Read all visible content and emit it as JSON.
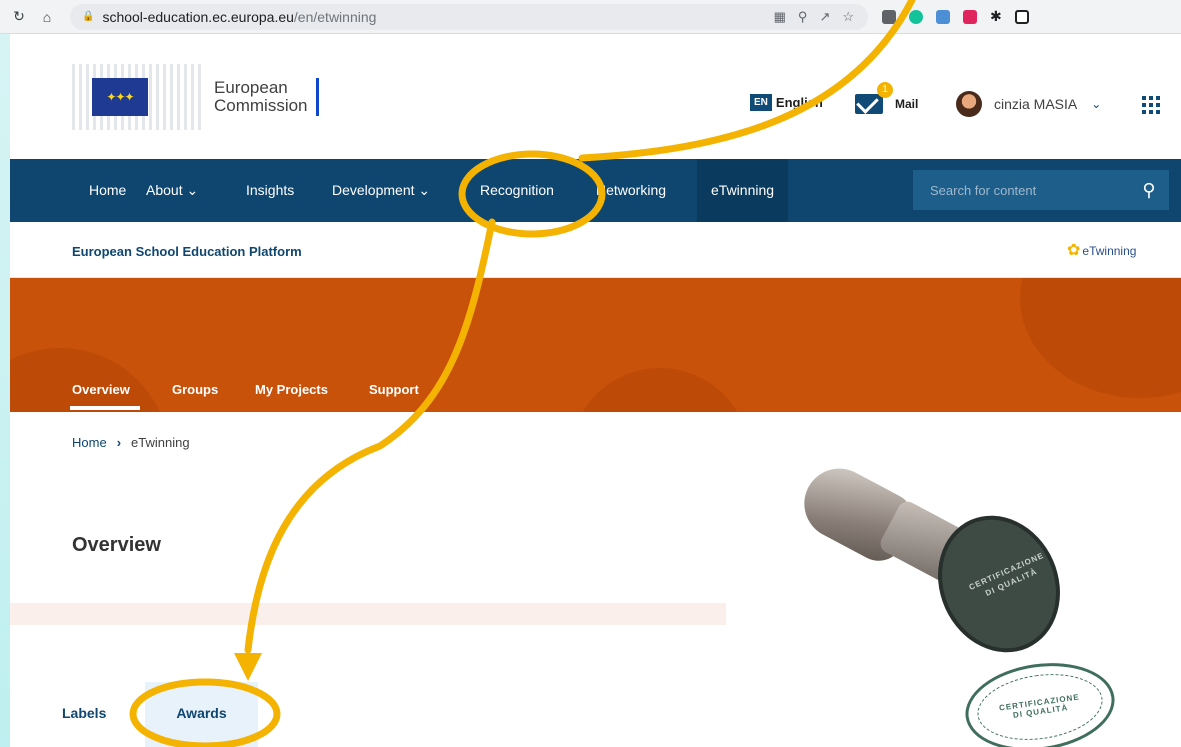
{
  "browser": {
    "url_host": "school-education.ec.europa.eu",
    "url_path": "/en/etwinning"
  },
  "header": {
    "logo_line1": "European",
    "logo_line2": "Commission",
    "lang_code": "EN",
    "lang_label": "English",
    "mail_count": "1",
    "mail_label": "Mail",
    "user_name": "cinzia MASIA"
  },
  "mainnav": {
    "items": [
      "Home",
      "About",
      "Insights",
      "Development",
      "Recognition",
      "Networking",
      "eTwinning"
    ],
    "search_placeholder": "Search for content"
  },
  "site": {
    "title": "European School Education Platform",
    "logo_text": "eTwinning"
  },
  "subnav": {
    "items": [
      "Overview",
      "Groups",
      "My Projects",
      "Support"
    ]
  },
  "breadcrumb": {
    "home": "Home",
    "current": "eTwinning"
  },
  "content": {
    "heading": "Overview",
    "tabs": [
      "Labels",
      "Awards"
    ]
  },
  "illustration": {
    "stamp_face": "CERTIFICAZIONE DI QUALITÀ",
    "imprint_line1": "CERTIFICAZIONE",
    "imprint_line2": "DI QUALITÀ"
  },
  "colors": {
    "nav": "#0e4670",
    "hero": "#c9520b",
    "annotation": "#f5b301"
  }
}
